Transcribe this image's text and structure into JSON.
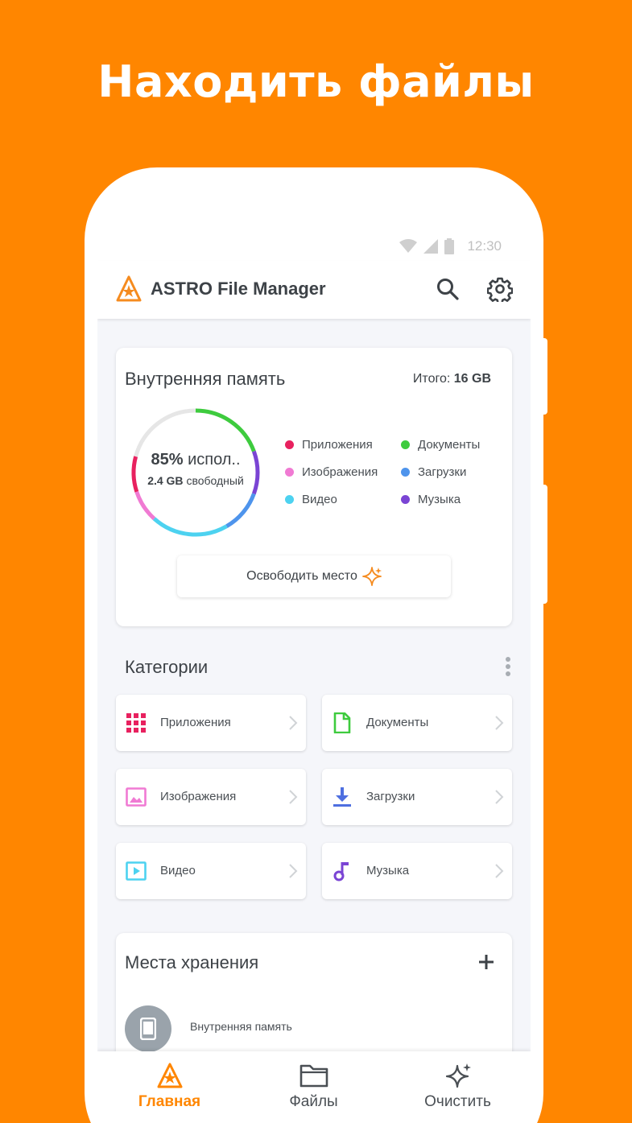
{
  "promo": {
    "title": "Находить файлы"
  },
  "status_bar": {
    "time": "12:30"
  },
  "app_bar": {
    "title": "ASTRO File Manager",
    "icons": [
      "astro-logo",
      "search-icon",
      "gear-icon"
    ]
  },
  "storage": {
    "heading": "Внутренняя память",
    "total_label": "Итого:",
    "total_value": "16 GB",
    "used_pct": "85%",
    "used_suffix": "испол..",
    "free_value": "2.4 GB",
    "free_suffix": "свободный",
    "legend": [
      {
        "label": "Приложения",
        "color": "#e8215f"
      },
      {
        "label": "Документы",
        "color": "#3ecb3e"
      },
      {
        "label": "Изображения",
        "color": "#f07ad3"
      },
      {
        "label": "Загрузки",
        "color": "#4e94ec"
      },
      {
        "label": "Видео",
        "color": "#4dd2f0"
      },
      {
        "label": "Музыка",
        "color": "#7a44d4"
      }
    ],
    "free_button": "Освободить место"
  },
  "categories": {
    "title": "Категории",
    "items": [
      {
        "label": "Приложения",
        "icon": "apps-grid-icon",
        "color": "#e8215f"
      },
      {
        "label": "Документы",
        "icon": "document-icon",
        "color": "#3ecb3e"
      },
      {
        "label": "Изображения",
        "icon": "image-icon",
        "color": "#f07ad3"
      },
      {
        "label": "Загрузки",
        "icon": "download-icon",
        "color": "#4e6fe0"
      },
      {
        "label": "Видео",
        "icon": "video-icon",
        "color": "#4dd2f0"
      },
      {
        "label": "Музыка",
        "icon": "music-icon",
        "color": "#7a44d4"
      }
    ]
  },
  "places": {
    "title": "Места хранения",
    "items": [
      {
        "label": "Внутренняя память",
        "icon": "phone-icon"
      }
    ]
  },
  "bottom_nav": {
    "items": [
      {
        "label": "Главная",
        "icon": "astro-logo",
        "active": true
      },
      {
        "label": "Файлы",
        "icon": "folder-icon",
        "active": false
      },
      {
        "label": "Очистить",
        "icon": "sparkle-icon",
        "active": false
      }
    ],
    "accent": "#ff8600"
  }
}
